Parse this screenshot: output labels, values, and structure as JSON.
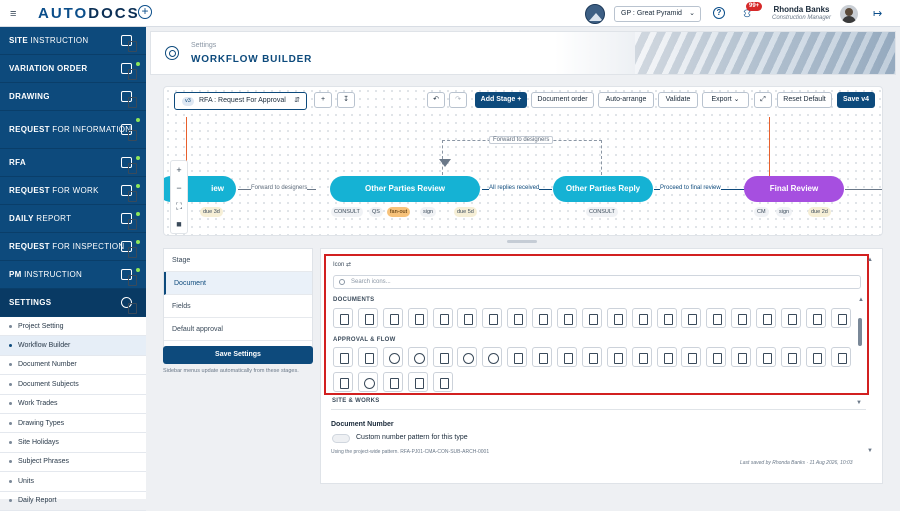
{
  "app": {
    "brand_a": "AUTO",
    "brand_b": "DOCS"
  },
  "project": {
    "label": "GP : Great Pyramid"
  },
  "notifications": {
    "badge": "99+"
  },
  "user": {
    "name": "Rhonda Banks",
    "role": "Construction Manager"
  },
  "sidebar": {
    "nav": [
      {
        "a": "SITE",
        "b": " INSTRUCTION"
      },
      {
        "a": "VARIATION ORDER",
        "b": ""
      },
      {
        "a": "DRAWING",
        "b": ""
      },
      {
        "a": "REQUEST",
        "b": " FOR INFORMATION"
      },
      {
        "a": "RFA",
        "b": ""
      },
      {
        "a": "REQUEST",
        "b": " FOR WORK"
      },
      {
        "a": "DAILY",
        "b": " REPORT"
      },
      {
        "a": "REQUEST",
        "b": " FOR INSPECTION"
      },
      {
        "a": "PM",
        "b": " INSTRUCTION"
      },
      {
        "a": "SETTINGS",
        "b": ""
      }
    ],
    "sub": [
      "Project Setting",
      "Workflow Builder",
      "Document Number",
      "Document Subjects",
      "Work Trades",
      "Drawing Types",
      "Site Holidays",
      "Subject Phrases",
      "Units",
      "Daily Report"
    ]
  },
  "header": {
    "crumb": "Settings",
    "title": "WORKFLOW BUILDER"
  },
  "toolbar": {
    "version": "v3",
    "workflow": "RFA : Request For Approval",
    "add_stage": "Add Stage +",
    "document_order": "Document order",
    "auto_arrange": "Auto-arrange",
    "validate": "Validate",
    "export": "Export",
    "reset": "Reset Default",
    "save": "Save v4"
  },
  "flow": {
    "stage1": "iew",
    "stage1_tags": [
      "gn",
      "due 3d"
    ],
    "edge1": "Forward to designers",
    "stage2": "Other Parties Review",
    "stage2_tags": [
      "CONSULT",
      "QS",
      "fan-out",
      "sign",
      "due 5d"
    ],
    "edge2": "All replies received",
    "stage3": "Other Parties Reply",
    "stage3_tags": [
      "CONSULT"
    ],
    "edge3": "Proceed to final review",
    "stage4": "Final Review",
    "stage4_tags": [
      "CM",
      "sign",
      "due 2d"
    ],
    "loop": "Forward to designers"
  },
  "left_panel": {
    "tabs": [
      "Stage",
      "Document",
      "Fields",
      "Default approval"
    ],
    "save": "Save Settings",
    "hint": "Sidebar menus update automatically from these stages."
  },
  "icon_picker": {
    "title": "Icon",
    "search_placeholder": "Search icons...",
    "sections": [
      "DOCUMENTS",
      "APPROVAL & FLOW",
      "SITE & WORKS"
    ]
  },
  "doc_number": {
    "title": "Document Number",
    "toggle_label": "Custom number pattern for this type",
    "note": "Using the project-wide pattern. RFA-PJ01-CMA-CON-SUB-ARCH-0001"
  },
  "footer": {
    "saved": "Last saved by Rhonda Banks · 11 Aug 2026, 10:03"
  }
}
